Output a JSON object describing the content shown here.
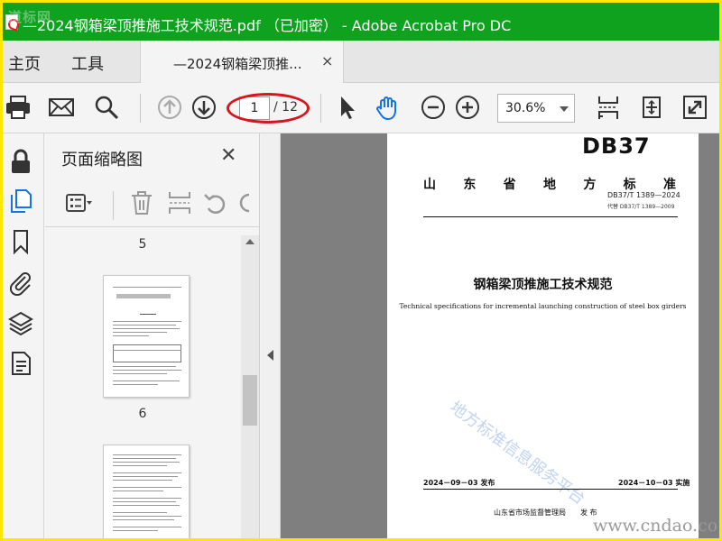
{
  "window": {
    "title": "—2024钢箱梁顶推施工技术规范.pdf （已加密） - Adobe Acrobat Pro DC",
    "logo_text": "道标网"
  },
  "nav": {
    "home": "主页",
    "tools": "工具",
    "doc_tab": "—2024钢箱梁顶推...",
    "close_glyph": "×"
  },
  "toolbar": {
    "current_page": "1",
    "total_pages": "/ 12",
    "zoom": "30.6%",
    "icons": [
      "print-icon",
      "mail-icon",
      "search-icon",
      "page-up-icon",
      "page-down-icon",
      "select-arrow-icon",
      "hand-icon",
      "zoom-out-icon",
      "zoom-in-icon",
      "fit-page-icon",
      "rotate-view-icon",
      "full-screen-icon"
    ],
    "accent": "#1473e6"
  },
  "rail": {
    "icons": [
      "lock-icon",
      "pages-icon",
      "bookmark-icon",
      "attachment-icon",
      "layers-icon",
      "document-icon"
    ]
  },
  "thumbnails": {
    "title": "页面缩略图",
    "close_glyph": "✕",
    "pages": [
      {
        "label": "5"
      },
      {
        "label": "6"
      }
    ]
  },
  "document": {
    "code": "DB37",
    "province_chars": [
      "山",
      "东",
      "省",
      "地",
      "方",
      "标",
      "准"
    ],
    "standard_no": "DB37/T 1389—2024",
    "replaces": "代替 DB37/T 1389—2009",
    "title_cn": "钢箱梁顶推施工技术规范",
    "title_en": "Technical specifications for incremental launching construction of steel box girders",
    "publish_date": "2024－09－03 发布",
    "implement_date": "2024－10－03 实施",
    "issuer": "山东省市场监督管理局",
    "issue_word": "发 布",
    "watermark": "地方标准信息服务平台"
  },
  "site_url": "www.cndao.co",
  "colors": {
    "titlebar": "#0ea21f",
    "frame": "#ffe800",
    "highlight_oval": "#d8141c"
  }
}
